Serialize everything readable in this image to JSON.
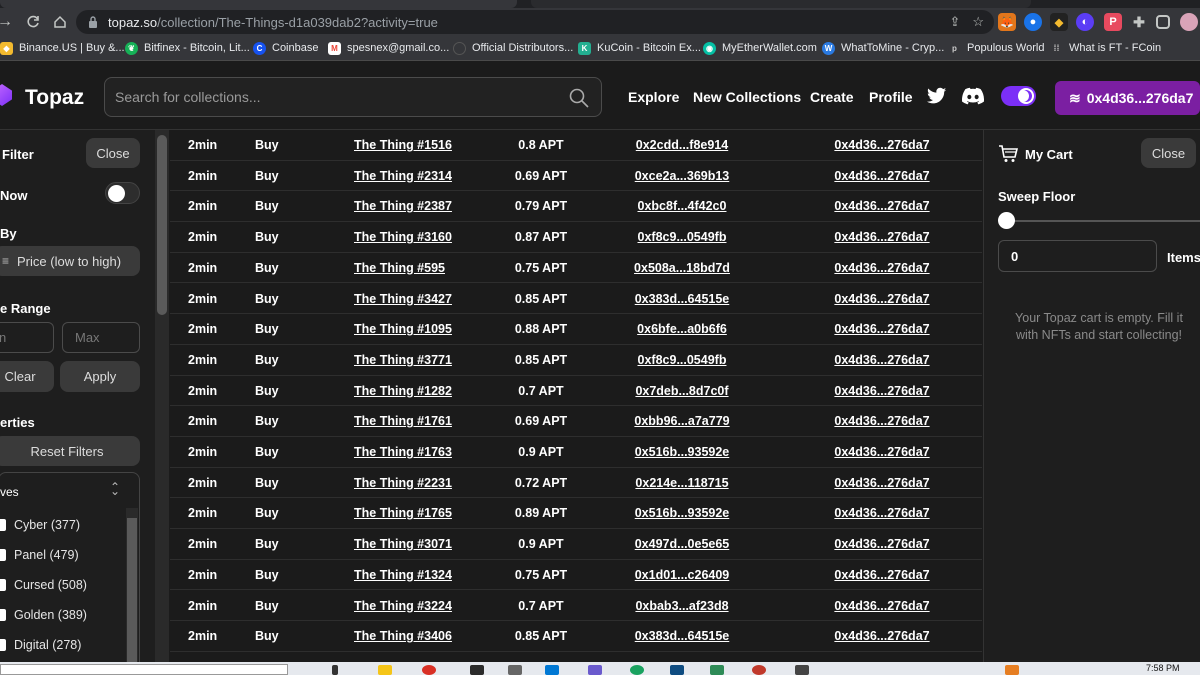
{
  "browser": {
    "url_host": "topaz.so",
    "url_path": "/collection/The-Things-d1a039dab2?activity=true",
    "bookmarks": [
      {
        "label": "Binance.US | Buy &...",
        "icon": "binance-icon",
        "color": "#f3ba2f"
      },
      {
        "label": "Bitfinex - Bitcoin, Lit...",
        "icon": "bitfinex-leaf-icon",
        "color": "#16b157"
      },
      {
        "label": "Coinbase",
        "icon": "coinbase-icon",
        "color": "#1652f0"
      },
      {
        "label": "spesnex@gmail.co...",
        "icon": "gmail-icon",
        "color": "#ea4335"
      },
      {
        "label": "Official Distributors...",
        "icon": "globe-icon",
        "color": "#555555"
      },
      {
        "label": "KuCoin - Bitcoin Ex...",
        "icon": "kucoin-icon",
        "color": "#23af91"
      },
      {
        "label": "MyEtherWallet.com",
        "icon": "myetherwallet-icon",
        "color": "#05c0a5"
      },
      {
        "label": "WhatToMine - Cryp...",
        "icon": "whattomine-icon",
        "color": "#2a7ae2"
      },
      {
        "label": "Populous World",
        "icon": "populous-icon",
        "color": "#cccccc"
      },
      {
        "label": "What is FT - FCoin",
        "icon": "fcoin-icon",
        "color": "#bbbbbb"
      }
    ]
  },
  "header": {
    "logo": "Topaz",
    "search_placeholder": "Search for collections...",
    "nav": [
      "Explore",
      "New Collections",
      "Create",
      "Profile"
    ],
    "wallet": "0x4d36...276da7"
  },
  "left_panel": {
    "filter_label": "Filter",
    "close_label": "Close",
    "now_label": "Now",
    "by_label": "By",
    "sort_value": "Price (low to high)",
    "range_label": "e Range",
    "min_placeholder": "n",
    "max_placeholder": "Max",
    "clear_label": "Clear",
    "apply_label": "Apply",
    "properties_label": "erties",
    "reset_label": "Reset Filters",
    "trait_group": "ves",
    "traits": [
      "Cyber (377)",
      "Panel (479)",
      "Cursed (508)",
      "Golden (389)",
      "Digital (278)"
    ]
  },
  "activity": [
    {
      "time": "2min",
      "type": "Buy",
      "name": "The Thing #1516",
      "price": "0.8 APT",
      "from": "0x2cdd...f8e914",
      "to": "0x4d36...276da7"
    },
    {
      "time": "2min",
      "type": "Buy",
      "name": "The Thing #2314",
      "price": "0.69 APT",
      "from": "0xce2a...369b13",
      "to": "0x4d36...276da7"
    },
    {
      "time": "2min",
      "type": "Buy",
      "name": "The Thing #2387",
      "price": "0.79 APT",
      "from": "0xbc8f...4f42c0",
      "to": "0x4d36...276da7"
    },
    {
      "time": "2min",
      "type": "Buy",
      "name": "The Thing #3160",
      "price": "0.87 APT",
      "from": "0xf8c9...0549fb",
      "to": "0x4d36...276da7"
    },
    {
      "time": "2min",
      "type": "Buy",
      "name": "The Thing #595",
      "price": "0.75 APT",
      "from": "0x508a...18bd7d",
      "to": "0x4d36...276da7"
    },
    {
      "time": "2min",
      "type": "Buy",
      "name": "The Thing #3427",
      "price": "0.85 APT",
      "from": "0x383d...64515e",
      "to": "0x4d36...276da7"
    },
    {
      "time": "2min",
      "type": "Buy",
      "name": "The Thing #1095",
      "price": "0.88 APT",
      "from": "0x6bfe...a0b6f6",
      "to": "0x4d36...276da7"
    },
    {
      "time": "2min",
      "type": "Buy",
      "name": "The Thing #3771",
      "price": "0.85 APT",
      "from": "0xf8c9...0549fb",
      "to": "0x4d36...276da7"
    },
    {
      "time": "2min",
      "type": "Buy",
      "name": "The Thing #1282",
      "price": "0.7 APT",
      "from": "0x7deb...8d7c0f",
      "to": "0x4d36...276da7"
    },
    {
      "time": "2min",
      "type": "Buy",
      "name": "The Thing #1761",
      "price": "0.69 APT",
      "from": "0xbb96...a7a779",
      "to": "0x4d36...276da7"
    },
    {
      "time": "2min",
      "type": "Buy",
      "name": "The Thing #1763",
      "price": "0.9 APT",
      "from": "0x516b...93592e",
      "to": "0x4d36...276da7"
    },
    {
      "time": "2min",
      "type": "Buy",
      "name": "The Thing #2231",
      "price": "0.72 APT",
      "from": "0x214e...118715",
      "to": "0x4d36...276da7"
    },
    {
      "time": "2min",
      "type": "Buy",
      "name": "The Thing #1765",
      "price": "0.89 APT",
      "from": "0x516b...93592e",
      "to": "0x4d36...276da7"
    },
    {
      "time": "2min",
      "type": "Buy",
      "name": "The Thing #3071",
      "price": "0.9 APT",
      "from": "0x497d...0e5e65",
      "to": "0x4d36...276da7"
    },
    {
      "time": "2min",
      "type": "Buy",
      "name": "The Thing #1324",
      "price": "0.75 APT",
      "from": "0x1d01...c26409",
      "to": "0x4d36...276da7"
    },
    {
      "time": "2min",
      "type": "Buy",
      "name": "The Thing #3224",
      "price": "0.7 APT",
      "from": "0xbab3...af23d8",
      "to": "0x4d36...276da7"
    },
    {
      "time": "2min",
      "type": "Buy",
      "name": "The Thing #3406",
      "price": "0.85 APT",
      "from": "0x383d...64515e",
      "to": "0x4d36...276da7"
    }
  ],
  "cart": {
    "title": "My Cart",
    "close_label": "Close",
    "sweep_label": "Sweep Floor",
    "sweep_value": 0,
    "items_value": "0",
    "items_label": "Items",
    "empty_text": "Your Topaz cart is empty. Fill it with NFTs and start collecting!"
  },
  "taskbar": {
    "time": "7:58 PM"
  }
}
